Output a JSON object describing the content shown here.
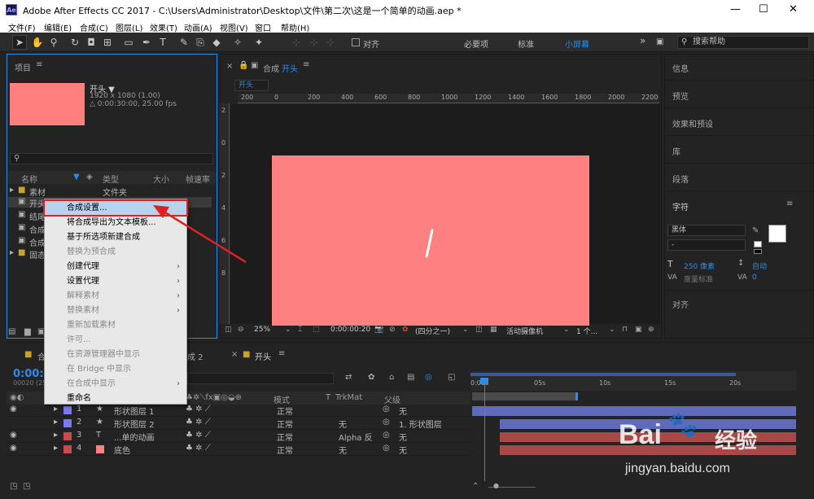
{
  "app": {
    "window_title": "Adobe After Effects CC 2017 - C:\\Users\\Administrator\\Desktop\\文件\\第二次\\这是一个简单的动画.aep *",
    "icon": "Ae"
  },
  "menu": [
    "文件(F)",
    "编辑(E)",
    "合成(C)",
    "图层(L)",
    "效果(T)",
    "动画(A)",
    "视图(V)",
    "窗口",
    "帮助(H)"
  ],
  "toolbar": {
    "align_label": "对齐",
    "workspaces": [
      "必要项",
      "标准",
      "小屏幕"
    ],
    "search_placeholder": "搜索帮助"
  },
  "project": {
    "title": "项目",
    "comp_name": "开头 ▼",
    "comp_res": "1920 x 1080 (1.00)",
    "comp_dur": "△ 0:00:30:00, 25.00 fps",
    "cols": {
      "name": "名称",
      "type": "类型",
      "size": "大小",
      "fps": "帧速率"
    },
    "items": [
      {
        "name": "素材",
        "type": "文件夹"
      },
      {
        "name": "开头",
        "type": ""
      },
      {
        "name": "结尾",
        "type": ""
      },
      {
        "name": "合成",
        "type": ""
      },
      {
        "name": "合成",
        "type": ""
      },
      {
        "name": "固态",
        "type": ""
      }
    ]
  },
  "context_menu": [
    {
      "label": "合成设置...",
      "state": "highlight"
    },
    {
      "label": "将合成导出为文本模板...",
      "state": "normal"
    },
    {
      "label": "基于所选项新建合成",
      "state": "normal"
    },
    {
      "label": "替换为预合成",
      "state": "disabled"
    },
    {
      "label": "创建代理",
      "state": "submenu"
    },
    {
      "label": "设置代理",
      "state": "submenu"
    },
    {
      "label": "解释素材",
      "state": "disabled-sub"
    },
    {
      "label": "替换素材",
      "state": "disabled-sub"
    },
    {
      "label": "重新加载素材",
      "state": "disabled"
    },
    {
      "label": "许可...",
      "state": "disabled"
    },
    {
      "label": "在资源管理器中显示",
      "state": "disabled"
    },
    {
      "label": "在 Bridge 中显示",
      "state": "disabled"
    },
    {
      "label": "在合成中显示",
      "state": "disabled-sub"
    },
    {
      "label": "重命名",
      "state": "normal"
    }
  ],
  "comp": {
    "tab_prefix": "合成",
    "tab_name": "开头",
    "flow_tab": "开头",
    "zoom": "25%",
    "timecode": "0:00:00:20",
    "resolution": "(四分之一)",
    "camera": "活动摄像机",
    "views": "1 个...",
    "ruler_h": [
      "200",
      "0",
      "200",
      "400",
      "600",
      "800",
      "1000",
      "1200",
      "1400",
      "1600",
      "1800",
      "2000",
      "2200"
    ],
    "ruler_v": [
      "2",
      "0",
      "2",
      "4",
      "6",
      "8"
    ]
  },
  "right": {
    "info": "信息",
    "preview": "预览",
    "effects": "效果和预设",
    "library": "库",
    "paragraph": "段落",
    "character": "字符",
    "font": "黑体",
    "style": "-",
    "size": "250 像素",
    "leading": "自动",
    "tracking": "度量标准",
    "kerning": "0",
    "align": "对齐"
  },
  "timeline": {
    "tabs": [
      "合",
      "成 2",
      "开头"
    ],
    "timecode": "0:00:",
    "fps_small": "00020 (25",
    "cols": {
      "mode": "模式",
      "t": "T",
      "trkmat": "TrkMat",
      "parent": "父级"
    },
    "ticks": [
      "0:00s",
      "05s",
      "10s",
      "15s",
      "20s"
    ],
    "layers": [
      {
        "num": "1",
        "kind": "★",
        "name": "形状图层 1",
        "mode": "正常",
        "trk": "",
        "parent": "无",
        "color": "#7a7af0"
      },
      {
        "num": "2",
        "kind": "★",
        "name": "形状图层 2",
        "mode": "正常",
        "trk": "无",
        "parent": "1. 形状图层",
        "color": "#7a7af0"
      },
      {
        "num": "3",
        "kind": "T",
        "name": "...单的动画",
        "mode": "正常",
        "trk": "Alpha 反",
        "parent": "无",
        "color": "#c84b4b"
      },
      {
        "num": "4",
        "kind": "",
        "name": "底色",
        "mode": "正常",
        "trk": "无",
        "parent": "无",
        "color": "#c84b4b"
      }
    ]
  },
  "watermark": {
    "brand": "Bai",
    "brand2": "经验",
    "url": "jingyan.baidu.com"
  },
  "colors": {
    "comp_fill": "#ff8080",
    "accent": "#2d8ceb",
    "annotation": "#e02020"
  }
}
